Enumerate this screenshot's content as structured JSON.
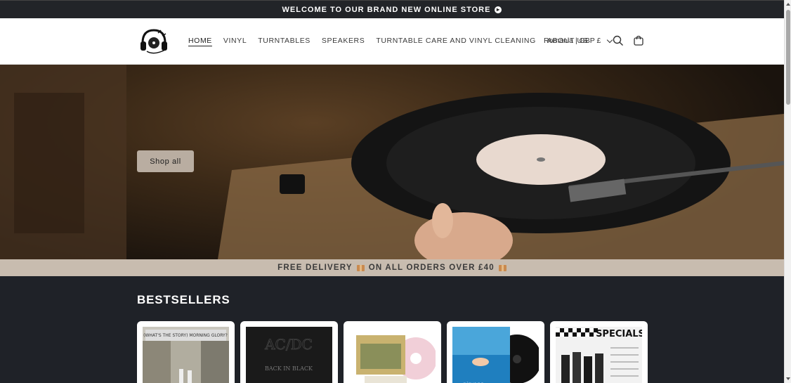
{
  "announcement": {
    "text": "WELCOME TO OUR BRAND NEW ONLINE STORE",
    "icon": "arrow-right-circle-icon"
  },
  "header": {
    "logo_icon": "headphones-logo-icon",
    "nav": [
      {
        "label": "HOME",
        "active": true
      },
      {
        "label": "VINYL",
        "active": false
      },
      {
        "label": "TURNTABLES",
        "active": false
      },
      {
        "label": "SPEAKERS",
        "active": false
      },
      {
        "label": "TURNTABLE CARE AND VINYL CLEANING",
        "active": false
      },
      {
        "label": "ABOUT US",
        "active": false
      }
    ],
    "locale": "Romania | GBP £",
    "icons": [
      "chevron-down-icon",
      "search-icon",
      "cart-icon"
    ]
  },
  "hero": {
    "button_label": "Shop all"
  },
  "promo": {
    "part1": "FREE DELIVERY",
    "part2": "ON ALL ORDERS OVER £40",
    "icon": "package-icon"
  },
  "bestsellers": {
    "title": "BESTSELLERS",
    "products": [
      {
        "art": "oasis-morning-glory-cover",
        "cover_text": "(WHAT'S THE STORY) MORNING GLORY?"
      },
      {
        "art": "acdc-back-in-black-cover",
        "cover_text": "BACK IN BLACK"
      },
      {
        "art": "oasis-pink-vinyl-cover",
        "cover_text": ""
      },
      {
        "art": "nirvana-nevermind-cover",
        "cover_text": ""
      },
      {
        "art": "specials-cover",
        "cover_text": "SPECIALS"
      }
    ]
  },
  "colors": {
    "announcement_bg": "#222428",
    "hero_button_bg": "#b9ada1",
    "promo_bg": "#c8bcaf",
    "bestsellers_bg": "#1f2228"
  }
}
